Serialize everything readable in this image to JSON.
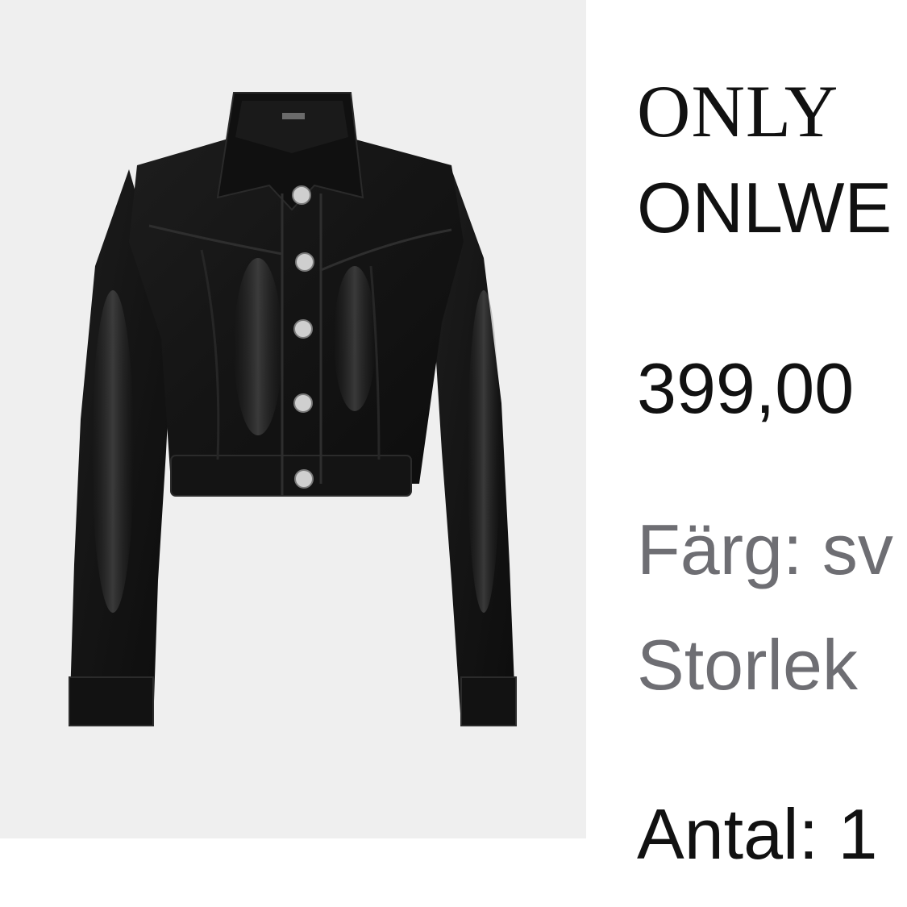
{
  "product": {
    "image_alt": "Black cropped faux-leather button jacket",
    "brand": "ONLY",
    "name": "ONLWE",
    "price": "399,00",
    "color_label": "Färg: sv",
    "size_label": "Storlek",
    "quantity_label": "Antal: 1"
  }
}
